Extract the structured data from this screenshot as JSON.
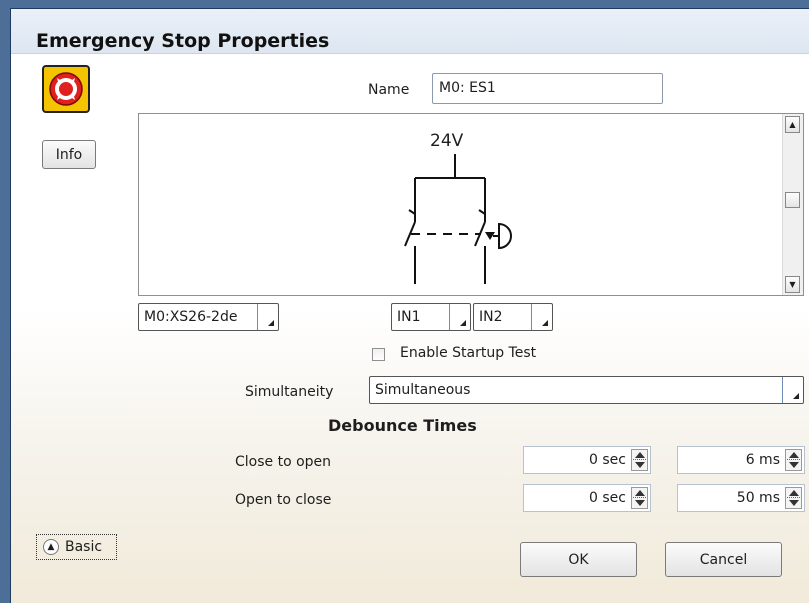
{
  "dialog": {
    "title": "Emergency Stop Properties"
  },
  "icon_bar": {
    "device_icon": "emergency-stop-icon",
    "info_label": "Info"
  },
  "name_field": {
    "label": "Name",
    "value": "M0: ES1"
  },
  "diagram": {
    "voltage_label": "24V"
  },
  "io": {
    "module_value": "M0:XS26-2de",
    "input1_value": "IN1",
    "input2_value": "IN2"
  },
  "startup_test": {
    "label": "Enable Startup Test",
    "checked": false
  },
  "simultaneity": {
    "label": "Simultaneity",
    "value": "Simultaneous"
  },
  "debounce": {
    "title": "Debounce Times",
    "rows": [
      {
        "label": "Close to open",
        "sec_value": "0 sec",
        "ms_value": "6 ms"
      },
      {
        "label": "Open to close",
        "sec_value": "0 sec",
        "ms_value": "50 ms"
      }
    ]
  },
  "footer": {
    "basic_label": "Basic",
    "ok_label": "OK",
    "cancel_label": "Cancel"
  },
  "colors": {
    "window_frame": "#4d6e97",
    "estop_yellow": "#f5c400",
    "estop_red": "#e0201e"
  }
}
